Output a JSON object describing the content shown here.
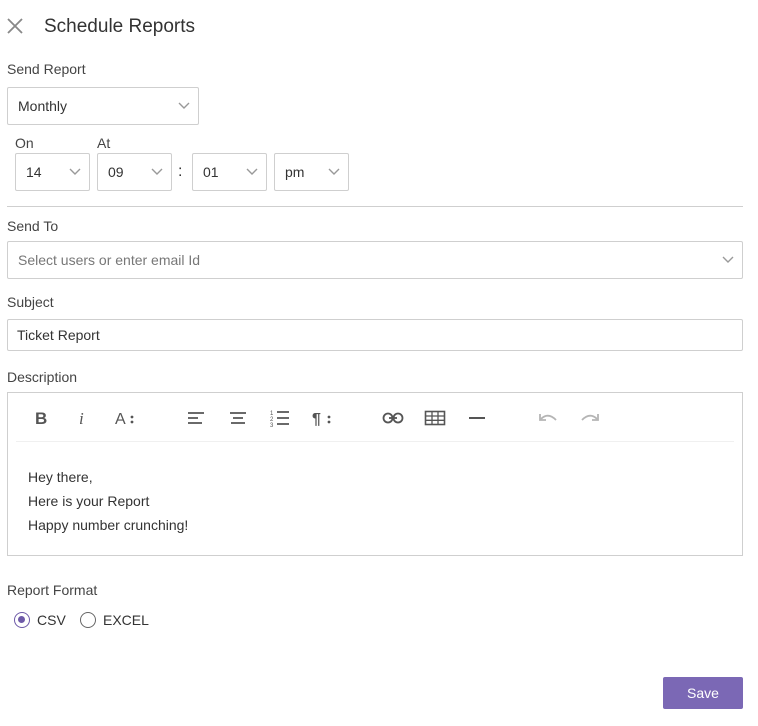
{
  "header": {
    "title": "Schedule Reports"
  },
  "send_report": {
    "label": "Send Report",
    "frequency": "Monthly",
    "on_label": "On",
    "at_label": "At",
    "day": "14",
    "hour": "09",
    "separator": ":",
    "minute": "01",
    "ampm": "pm"
  },
  "send_to": {
    "label": "Send To",
    "placeholder": "Select users or enter email Id"
  },
  "subject": {
    "label": "Subject",
    "value": "Ticket Report"
  },
  "description": {
    "label": "Description",
    "lines": [
      "Hey there,",
      "Here is your Report",
      "Happy number crunching!"
    ]
  },
  "report_format": {
    "label": "Report Format",
    "options": [
      {
        "label": "CSV",
        "selected": true
      },
      {
        "label": "EXCEL",
        "selected": false
      }
    ]
  },
  "save_label": "Save",
  "colors": {
    "accent": "#7b68b5",
    "border": "#cfcfcf",
    "icon": "#555555",
    "disabled_icon": "#b5b5b5"
  }
}
